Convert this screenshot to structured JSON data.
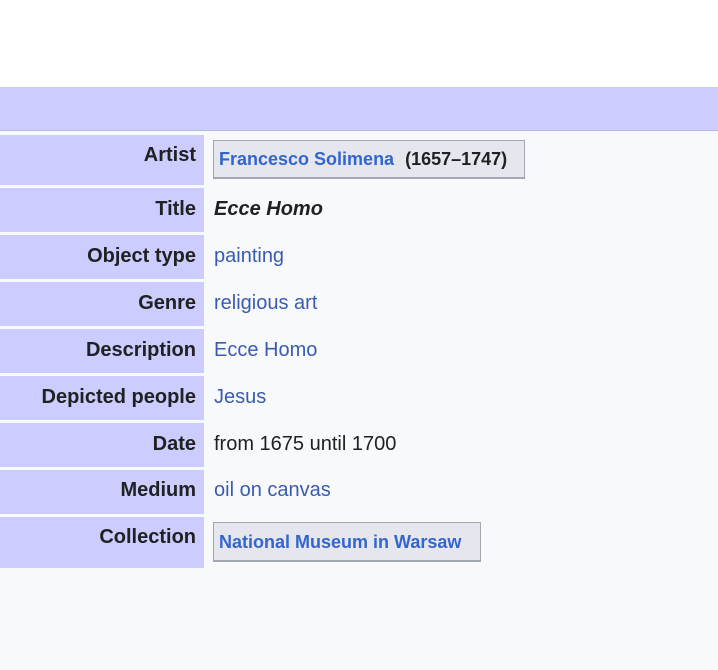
{
  "rows": [
    {
      "label": "Artist",
      "value_name": "Francesco Solimena",
      "value_extra": "(1657–1747)"
    },
    {
      "label": "Title",
      "value": "Ecce Homo"
    },
    {
      "label": "Object type",
      "value": "painting"
    },
    {
      "label": "Genre",
      "value": "religious art"
    },
    {
      "label": "Description",
      "value": "Ecce Homo"
    },
    {
      "label": "Depicted people",
      "value": "Jesus"
    },
    {
      "label": "Date",
      "value": "from 1675 until 1700"
    },
    {
      "label": "Medium",
      "value": "oil on canvas"
    },
    {
      "label": "Collection",
      "value": "National Museum in Warsaw"
    }
  ],
  "colors": {
    "label_bg": "#ccccff",
    "body_bg": "#f8f9fa",
    "link": "#3a5bb0",
    "text": "#202122"
  }
}
